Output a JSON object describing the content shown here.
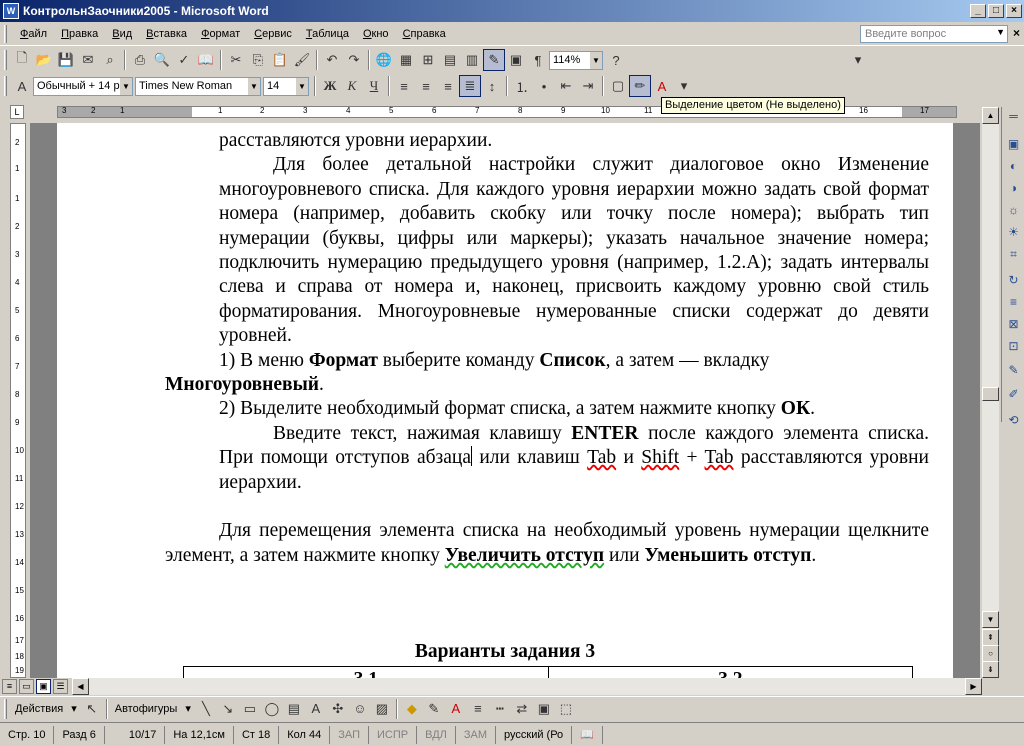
{
  "window": {
    "app_icon": "W",
    "title": "КонтрольнЗаочники2005 - Microsoft Word"
  },
  "menu": {
    "items": [
      "Файл",
      "Правка",
      "Вид",
      "Вставка",
      "Формат",
      "Сервис",
      "Таблица",
      "Окно",
      "Справка"
    ],
    "ask_placeholder": "Введите вопрос"
  },
  "toolbar": {
    "zoom": "114%",
    "style": "Обычный + 14 р",
    "font": "Times New Roman",
    "size": "14",
    "bold": "Ж",
    "italic": "К",
    "underline": "Ч",
    "tooltip": "Выделение цветом (Не выделено)"
  },
  "ruler": {
    "ticks": [
      "3",
      "2",
      "1",
      "1",
      "2",
      "3",
      "4",
      "5",
      "6",
      "7",
      "8",
      "9",
      "10",
      "11",
      "12",
      "13",
      "14",
      "15",
      "16",
      "17"
    ],
    "vticks": [
      "2",
      "1",
      "1",
      "2",
      "3",
      "4",
      "5",
      "6",
      "7",
      "8",
      "9",
      "10",
      "11",
      "12",
      "13",
      "14",
      "15",
      "16",
      "17",
      "18",
      "19"
    ]
  },
  "document": {
    "line0": "расставляются уровни иерархии.",
    "para1": "Для более детальной настройки служит диалоговое окно Изменение многоуровневого списка. Для каждого уровня иерархии можно задать свой формат номера (например, добавить скобку или точку после номера); выбрать тип нумерации (буквы, цифры или маркеры); указать начальное значение номера; подключить нумерацию предыдущего уровня (например, 1.2.А); задать интервалы слева и справа от номера и, наконец, присвоить каждому уровню свой стиль форматирования. Многоуровневые нумерованные списки содержат до девяти уровней.",
    "step1_pre": "1) В меню ",
    "step1_b1": "Формат",
    "step1_mid": " выберите команду ",
    "step1_b2": "Список",
    "step1_post": ", а затем — вкладку ",
    "step1_b3": "Многоуровневый",
    "step1_end": ".",
    "step2_pre": "2) Выделите необходимый формат списка, а затем нажмите кнопку ",
    "step2_b": "ОК",
    "step2_end": ".",
    "para3_pre": "Введите текст, нажимая клавишу ",
    "para3_b": "ENTER",
    "para3_mid": " после каждого элемента списка. При помощи отступов абзаца",
    "para3_mid2": " или клавиш ",
    "para3_tab": "Tab",
    "para3_and": " и ",
    "para3_shift": "Shift",
    "para3_plus": " + ",
    "para3_tab2": "Tab",
    "para3_end": " расставляются уровни иерархии.",
    "para4_pre": "Для перемещения элемента списка на необходимый уровень нумерации щелкните элемент, а затем нажмите кнопку ",
    "para4_b1": "Увеличить отступ",
    "para4_mid": " или ",
    "para4_b2": "Уменьшить отступ",
    "para4_end": ".",
    "table_title": "Варианты задания 3",
    "table_cells": [
      "3.1",
      "3.2"
    ]
  },
  "drawbar": {
    "actions": "Действия",
    "autoshapes": "Автофигуры"
  },
  "status": {
    "page": "Стр. 10",
    "section": "Разд 6",
    "pages": "10/17",
    "at": "На 12,1см",
    "line": "Ст 18",
    "col": "Кол 44",
    "rec": "ЗАП",
    "trk": "ИСПР",
    "ext": "ВДЛ",
    "ovr": "ЗАМ",
    "lang": "русский (Ро"
  },
  "colors": {
    "titlebar_start": "#0a246a",
    "titlebar_end": "#a6caf0",
    "chrome": "#d4d0c8",
    "page_bg": "#808080"
  }
}
